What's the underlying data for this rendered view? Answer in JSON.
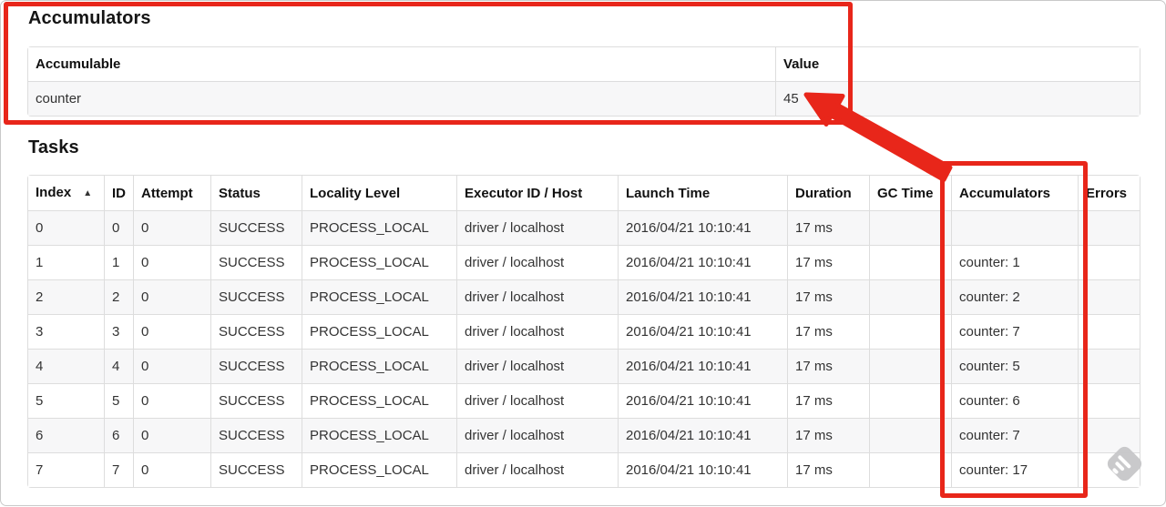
{
  "accumulators": {
    "title": "Accumulators",
    "headers": [
      "Accumulable",
      "Value"
    ],
    "sortable": false,
    "rows": [
      [
        "counter",
        "45"
      ]
    ]
  },
  "tasks": {
    "title": "Tasks",
    "headers": [
      "Index",
      "ID",
      "Attempt",
      "Status",
      "Locality Level",
      "Executor ID / Host",
      "Launch Time",
      "Duration",
      "GC Time",
      "Accumulators",
      "Errors"
    ],
    "sortable": true,
    "sorted_column": "Index",
    "sort_icon": "▲",
    "rows": [
      [
        "0",
        "0",
        "0",
        "SUCCESS",
        "PROCESS_LOCAL",
        "driver / localhost",
        "2016/04/21 10:10:41",
        "17 ms",
        "",
        "",
        ""
      ],
      [
        "1",
        "1",
        "0",
        "SUCCESS",
        "PROCESS_LOCAL",
        "driver / localhost",
        "2016/04/21 10:10:41",
        "17 ms",
        "",
        "counter: 1",
        ""
      ],
      [
        "2",
        "2",
        "0",
        "SUCCESS",
        "PROCESS_LOCAL",
        "driver / localhost",
        "2016/04/21 10:10:41",
        "17 ms",
        "",
        "counter: 2",
        ""
      ],
      [
        "3",
        "3",
        "0",
        "SUCCESS",
        "PROCESS_LOCAL",
        "driver / localhost",
        "2016/04/21 10:10:41",
        "17 ms",
        "",
        "counter: 7",
        ""
      ],
      [
        "4",
        "4",
        "0",
        "SUCCESS",
        "PROCESS_LOCAL",
        "driver / localhost",
        "2016/04/21 10:10:41",
        "17 ms",
        "",
        "counter: 5",
        ""
      ],
      [
        "5",
        "5",
        "0",
        "SUCCESS",
        "PROCESS_LOCAL",
        "driver / localhost",
        "2016/04/21 10:10:41",
        "17 ms",
        "",
        "counter: 6",
        ""
      ],
      [
        "6",
        "6",
        "0",
        "SUCCESS",
        "PROCESS_LOCAL",
        "driver / localhost",
        "2016/04/21 10:10:41",
        "17 ms",
        "",
        "counter: 7",
        ""
      ],
      [
        "7",
        "7",
        "0",
        "SUCCESS",
        "PROCESS_LOCAL",
        "driver / localhost",
        "2016/04/21 10:10:41",
        "17 ms",
        "",
        "counter: 17",
        ""
      ]
    ]
  },
  "annotations": {
    "highlight_color": "#e8261a",
    "box_1_target": "accumulators-section",
    "box_2_target": "accumulators-column",
    "arrow_points_to": "accumulator-value-45"
  }
}
